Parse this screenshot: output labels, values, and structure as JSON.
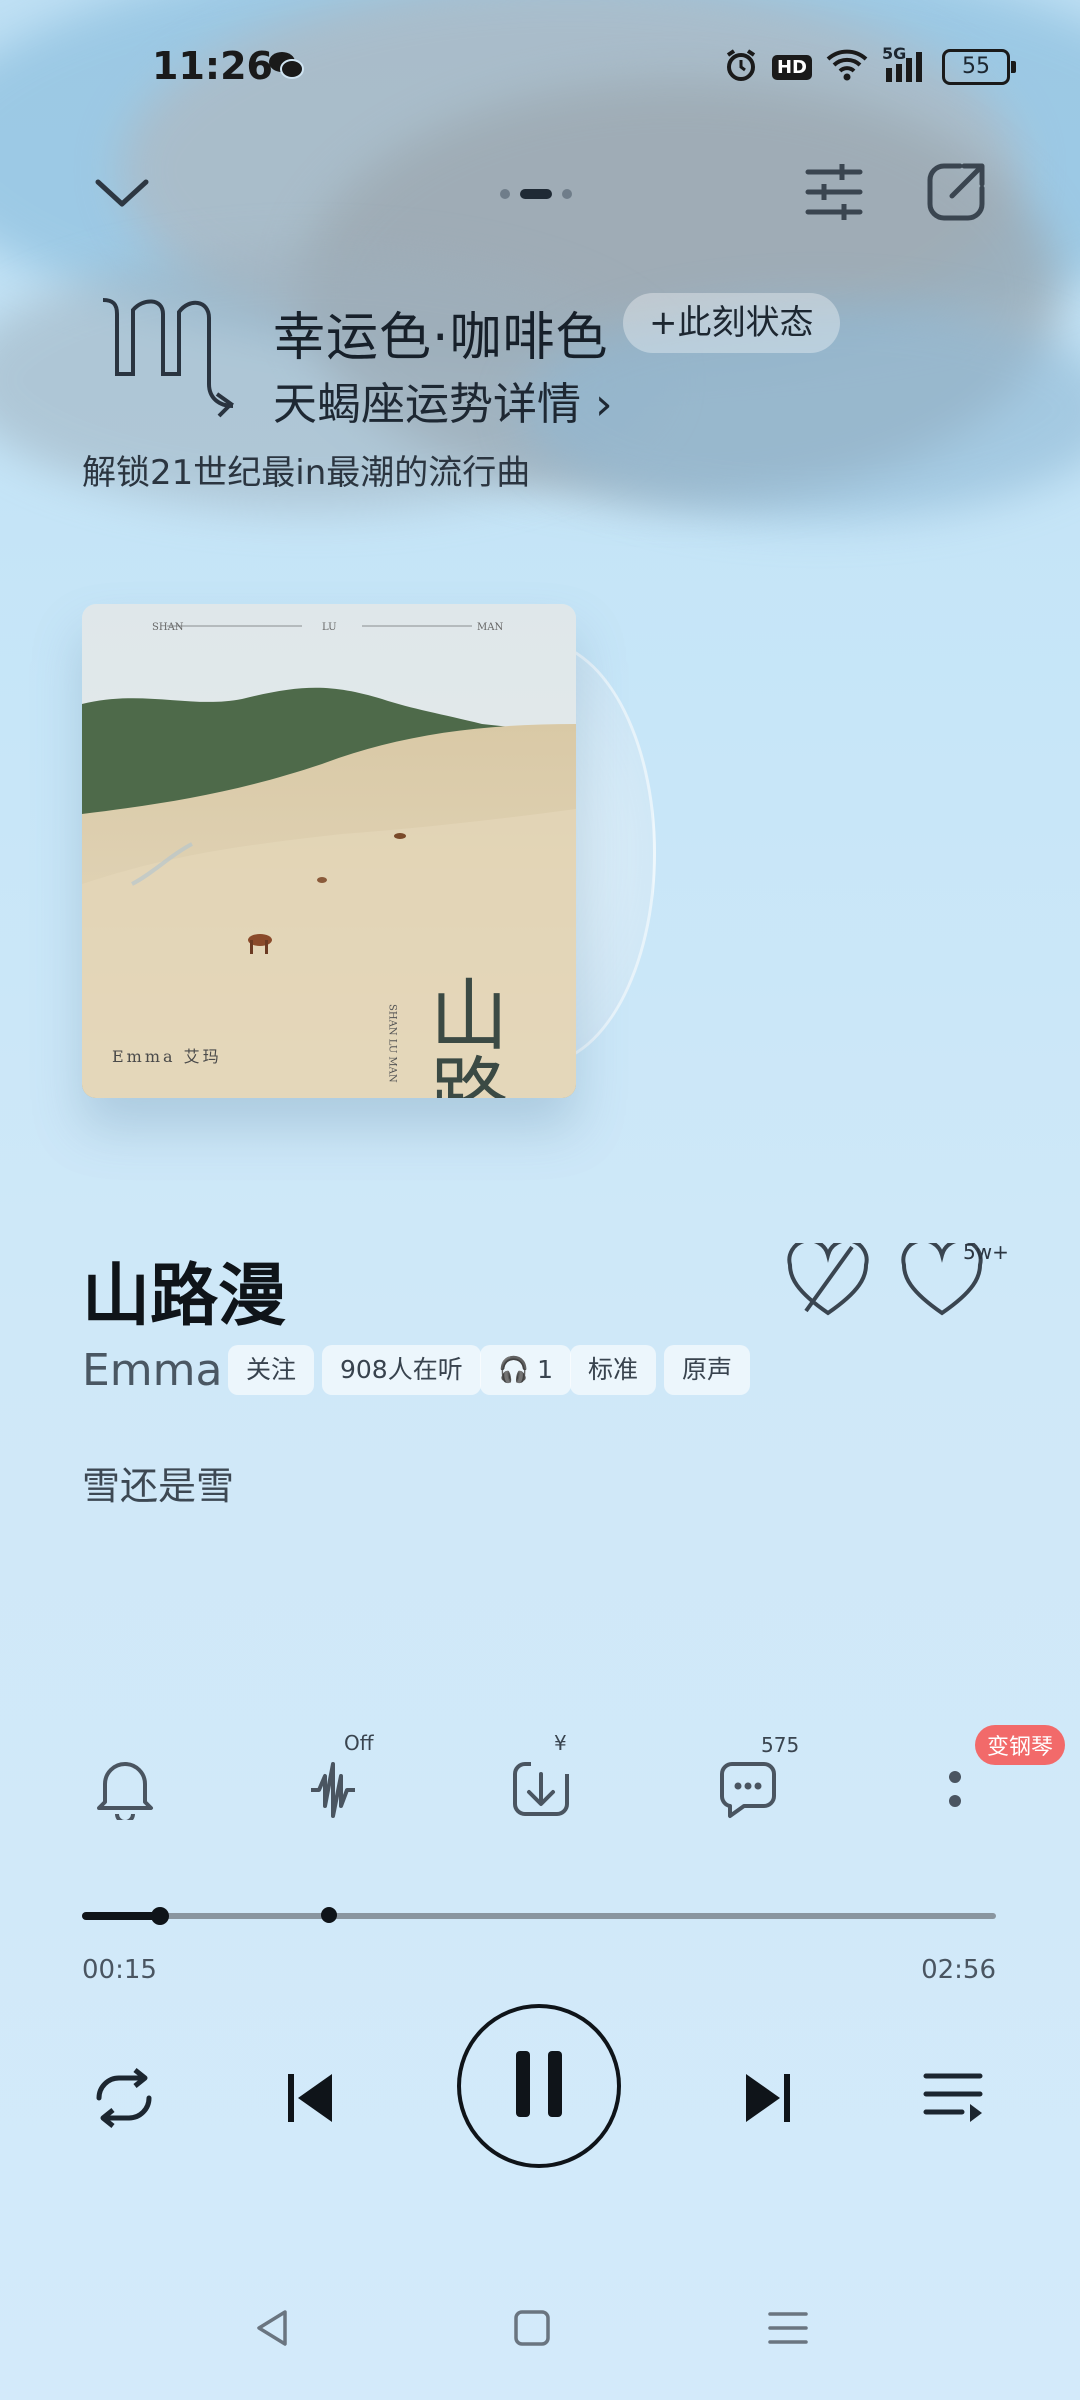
{
  "status_bar": {
    "time": "11:26",
    "network": "5G",
    "hd": "HD",
    "battery": "55"
  },
  "top_nav": {
    "page_dots": 3,
    "active_dot": 1
  },
  "horoscope": {
    "lucky_color": "幸运色·咖啡色",
    "status_tag": "+此刻状态",
    "fortune_link": "天蝎座运势详情 ›",
    "slogan": "解锁21世纪最in最潮的流行曲"
  },
  "album": {
    "header_left": "SHAN",
    "header_mid": "LU",
    "header_right": "MAN",
    "calligraphy": "山路漫",
    "vertical_text": "SHAN LU MAN",
    "artist_credit": "Emma 艾玛"
  },
  "song": {
    "title": "山路漫",
    "artist": "Emma",
    "follow": "关注",
    "listeners": "908人在听",
    "headphone_count": "1",
    "quality": "标准",
    "version": "原声",
    "lyric": "雪还是雪",
    "like_count": "5w+"
  },
  "actions": {
    "sound_effect_state": "Off",
    "download_price_mark": "¥",
    "comment_count": "575",
    "piano_badge": "变钢琴"
  },
  "player": {
    "current_time": "00:15",
    "total_time": "02:56",
    "progress": 0.0852,
    "buffer_marker": 0.27
  },
  "colors": {
    "accent": "#0f1419",
    "badge": "#f26a6a",
    "background": "#cfe8f8"
  }
}
